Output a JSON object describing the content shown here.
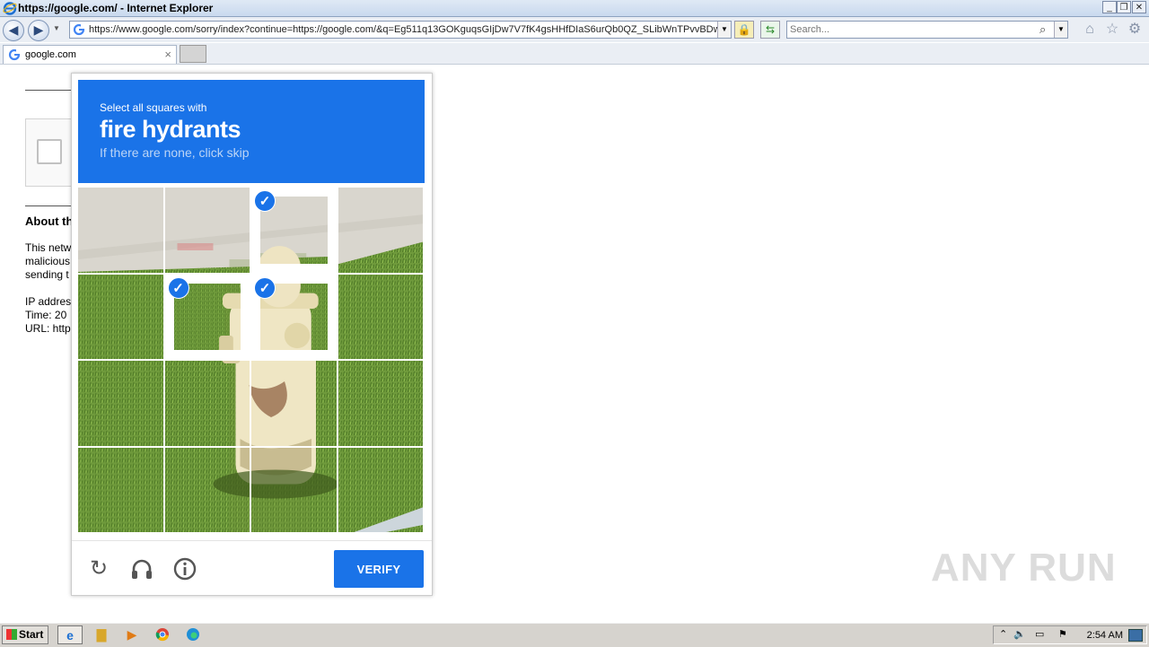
{
  "window": {
    "title": "https://google.com/ - Internet Explorer",
    "min_icon": "minimize-icon",
    "max_icon": "maximize-icon",
    "close_icon": "close-icon"
  },
  "address_bar": {
    "url": "https://www.google.com/sorry/index?continue=https://google.com/&q=Eg511q13GOKguqsGIjDw7V7fK4gsHHfDIaS6urQb0QZ_SLibWnTPvvBDwt",
    "search_placeholder": "Search..."
  },
  "tabs": [
    {
      "label": "google.com",
      "close": "×"
    }
  ],
  "background_page": {
    "about_heading": "About th",
    "para_lines": [
      "This netw",
      "malicious",
      "sending t"
    ],
    "info_lines": [
      "IP addres",
      "Time: 20",
      "URL: http"
    ]
  },
  "captcha": {
    "instruction_small": "Select all squares with",
    "target": "fire hydrants",
    "hint": "If there are none, click skip",
    "selected_tiles": [
      2,
      5,
      6
    ],
    "grid_size": 4,
    "verify_label": "VERIFY",
    "footer_icons": [
      "reload-icon",
      "audio-icon",
      "info-icon"
    ]
  },
  "watermark": "ANY RUN",
  "taskbar": {
    "start_label": "Start",
    "apps": [
      "internet-explorer-icon",
      "file-explorer-icon",
      "media-player-icon",
      "chrome-icon",
      "edge-icon"
    ],
    "clock": "2:54 AM"
  },
  "colors": {
    "accent": "#1a73e8",
    "hint_text": "#bcd5f6"
  }
}
